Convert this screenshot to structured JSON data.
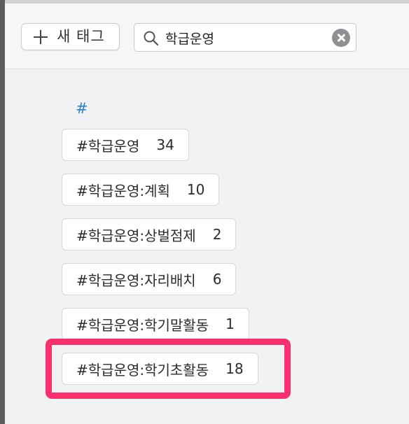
{
  "toolbar": {
    "new_tag_label": "새 태그",
    "search": {
      "value": "학급운영",
      "placeholder": ""
    }
  },
  "tag_list": {
    "section_header": "#",
    "tags": [
      {
        "name": "#학급운영",
        "count": "34"
      },
      {
        "name": "#학급운영:계획",
        "count": "10"
      },
      {
        "name": "#학급운영:상벌점제",
        "count": "2"
      },
      {
        "name": "#학급운영:자리배치",
        "count": "6"
      },
      {
        "name": "#학급운영:학기말활동",
        "count": "1"
      },
      {
        "name": "#학급운영:학기초활동",
        "count": "18",
        "highlighted": true
      }
    ]
  },
  "colors": {
    "accent": "#2f7fd1",
    "highlight": "#fb2e6e",
    "toolbar_bg": "#f6f6f7",
    "content_bg": "#f1f2f3"
  },
  "icons": [
    "plus-icon",
    "search-icon",
    "clear-search-icon"
  ]
}
